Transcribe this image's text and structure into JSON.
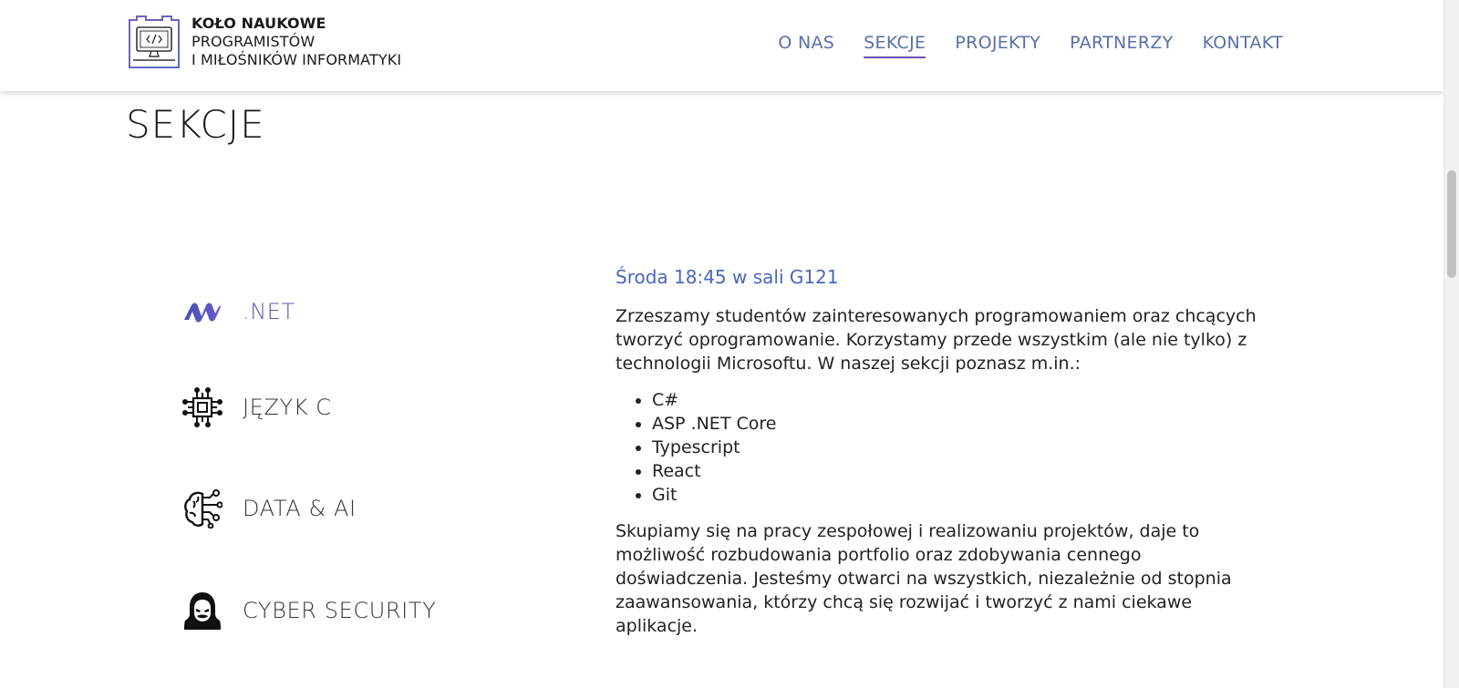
{
  "logo": {
    "line1": "KOŁO NAUKOWE",
    "line2": "PROGRAMISTÓW",
    "line3": "I MIŁOŚNIKÓW INFORMATYKI",
    "icon": "computer-code-icon"
  },
  "nav": {
    "items": [
      {
        "label": "O NAS",
        "active": false
      },
      {
        "label": "SEKCJE",
        "active": true
      },
      {
        "label": "PROJEKTY",
        "active": false
      },
      {
        "label": "PARTNERZY",
        "active": false
      },
      {
        "label": "KONTAKT",
        "active": false
      }
    ]
  },
  "page": {
    "title": "SEKCJE"
  },
  "sections": {
    "items": [
      {
        "label": ".NET",
        "icon": "dotnet-logo-icon",
        "active": true
      },
      {
        "label": "JĘZYK C",
        "icon": "chip-icon",
        "active": false
      },
      {
        "label": "DATA & AI",
        "icon": "brain-circuit-icon",
        "active": false
      },
      {
        "label": "CYBER SECURITY",
        "icon": "hacker-icon",
        "active": false
      }
    ]
  },
  "content": {
    "schedule": "Środa 18:45 w sali G121",
    "intro": "Zrzeszamy studentów zainteresowanych programowaniem oraz chcących tworzyć oprogramowanie. Korzystamy przede wszystkim (ale nie tylko) z technologii Microsoftu. W naszej sekcji poznasz m.in.:",
    "technologies": [
      "C#",
      "ASP .NET Core",
      "Typescript",
      "React",
      "Git"
    ],
    "outro": "Skupiamy się na pracy zespołowej i realizowaniu projektów, daje to możliwość rozbudowania portfolio oraz zdobywania cennego doświadczenia. Jesteśmy otwarci na wszystkich, niezależnie od stopnia zaawansowania, którzy chcą się rozwijać i tworzyć z nami ciekawe aplikacje."
  },
  "colors": {
    "nav_link": "#5a6fa8",
    "nav_active_underline": "#6b4fae",
    "schedule_text": "#4a66b8",
    "active_section": "#5b57b0"
  }
}
